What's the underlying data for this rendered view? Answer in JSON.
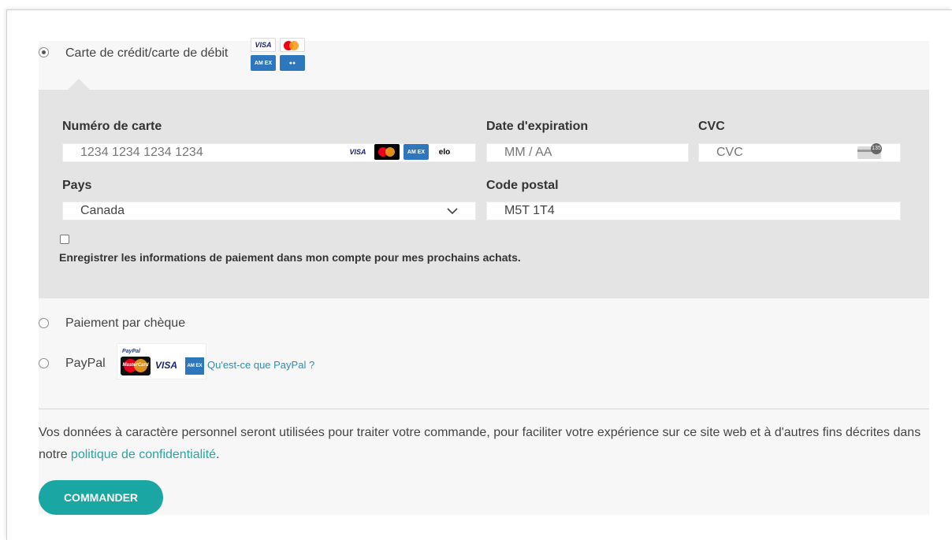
{
  "payment_options": {
    "card": {
      "label": "Carte de crédit/carte de débit",
      "selected": true
    },
    "cheque": {
      "label": "Paiement par chèque",
      "selected": false
    },
    "paypal": {
      "label": "PayPal",
      "selected": false,
      "brand_small": "PayPal",
      "what_is_link": "Qu'est-ce que PayPal ?"
    }
  },
  "card_logos": {
    "visa": "VISA",
    "amex": "AM EX",
    "elo": "elo",
    "mastercard_text": "MasterCard"
  },
  "card_form": {
    "number_label": "Numéro de carte",
    "number_placeholder": "1234 1234 1234 1234",
    "expiry_label": "Date d'expiration",
    "expiry_placeholder": "MM / AA",
    "cvc_label": "CVC",
    "cvc_placeholder": "CVC",
    "cvc_badge": "135",
    "country_label": "Pays",
    "country_value": "Canada",
    "postal_label": "Code postal",
    "postal_value": "M5T 1T4",
    "save_info_label": "Enregistrer les informations de paiement dans mon compte pour mes prochains achats.",
    "save_info_checked": false
  },
  "privacy": {
    "text_before": "Vos données à caractère personnel seront utilisées pour traiter votre commande, pour faciliter votre expérience sur ce site web et à d'autres fins décrites dans notre ",
    "link_text": "politique de confidentialité",
    "text_after": "."
  },
  "order_button": "COMMANDER",
  "colors": {
    "accent": "#1aa6a3",
    "link": "#2ba5a0",
    "panel_bg": "#f7f7f7",
    "form_bg": "#e4e4e4"
  }
}
